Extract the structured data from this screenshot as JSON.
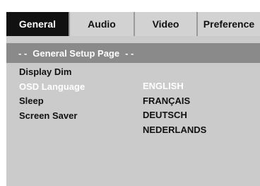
{
  "tabs": {
    "general": "General",
    "audio": "Audio",
    "video": "Video",
    "preference": "Preference"
  },
  "header": {
    "dash_left": "- -",
    "title": "General Setup Page",
    "dash_right": "- -"
  },
  "menu": {
    "items": [
      "Display Dim",
      "OSD Language",
      "Sleep",
      "Screen Saver"
    ],
    "selected_index": 1
  },
  "options": {
    "items": [
      "ENGLISH",
      "FRANÇAIS",
      "DEUTSCH",
      "NEDERLANDS"
    ],
    "selected_index": 0
  },
  "colors": {
    "panel_bg": "#cbcbcb",
    "active_tab_bg": "#111111",
    "header_bg": "#8a8a8a",
    "highlight_text": "#ffffff"
  }
}
